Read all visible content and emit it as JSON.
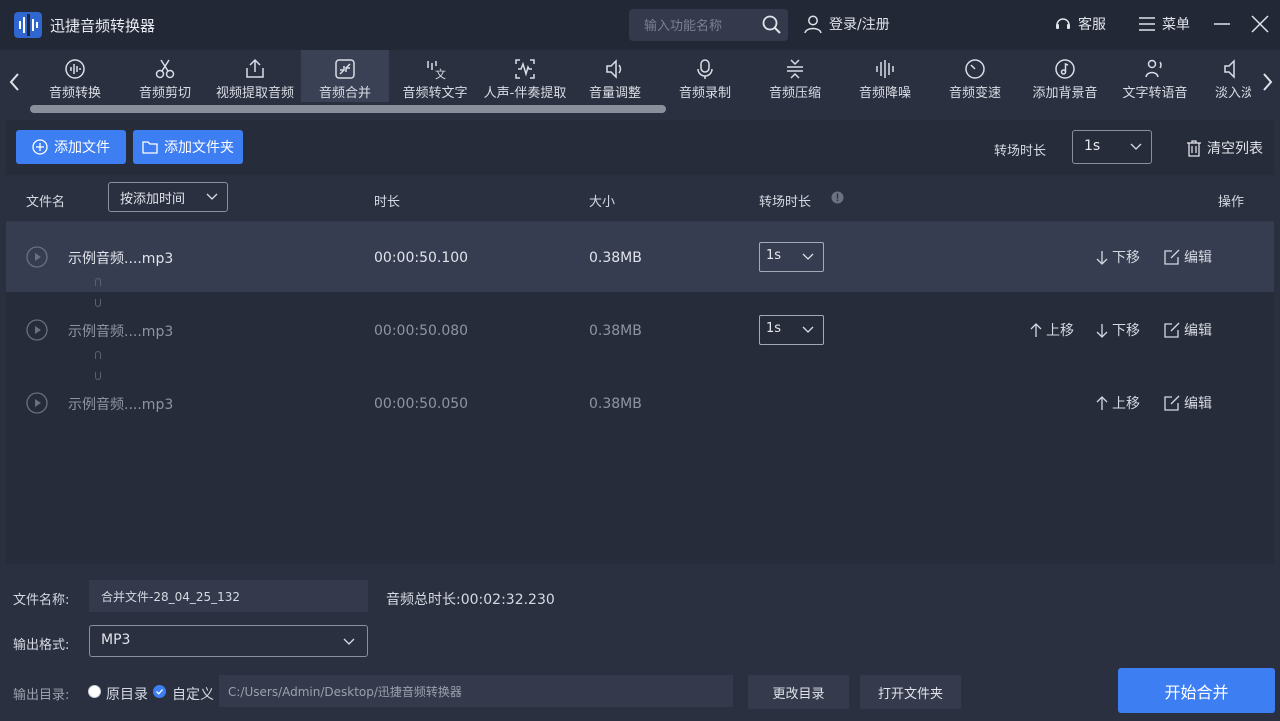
{
  "app": {
    "title": "迅捷音频转换器",
    "search_placeholder": "输入功能名称",
    "login_label": "登录/注册",
    "service_label": "客服",
    "menu_label": "菜单"
  },
  "toolbar": {
    "tools": [
      {
        "label": "音频转换",
        "icon": "waveform-circle-icon"
      },
      {
        "label": "音频剪切",
        "icon": "scissors-icon"
      },
      {
        "label": "视频提取音频",
        "icon": "export-icon"
      },
      {
        "label": "音频合并",
        "icon": "merge-icon",
        "active": true
      },
      {
        "label": "音频转文字",
        "icon": "audio-to-text-icon"
      },
      {
        "label": "人声-伴奏提取",
        "icon": "vocal-extract-icon"
      },
      {
        "label": "音量调整",
        "icon": "volume-icon"
      },
      {
        "label": "音频录制",
        "icon": "microphone-icon"
      },
      {
        "label": "音频压缩",
        "icon": "compress-icon"
      },
      {
        "label": "音频降噪",
        "icon": "denoise-icon"
      },
      {
        "label": "音频变速",
        "icon": "speed-icon"
      },
      {
        "label": "添加背景音",
        "icon": "music-note-icon"
      },
      {
        "label": "文字转语音",
        "icon": "text-to-speech-icon"
      },
      {
        "label": "淡入淡",
        "icon": "fade-icon"
      }
    ]
  },
  "actions": {
    "add_file": "添加文件",
    "add_folder": "添加文件夹",
    "transition_label": "转场时长",
    "transition_value": "1s",
    "clear_list": "清空列表"
  },
  "table": {
    "headers": {
      "filename": "文件名",
      "sort": "按添加时间",
      "duration": "时长",
      "size": "大小",
      "transition": "转场时长",
      "operation": "操作"
    },
    "rows": [
      {
        "name": "示例音频....mp3",
        "duration": "00:00:50.100",
        "size": "0.38MB",
        "transition": "1s",
        "up": "",
        "down": "下移",
        "edit": "编辑"
      },
      {
        "name": "示例音频....mp3",
        "duration": "00:00:50.080",
        "size": "0.38MB",
        "transition": "1s",
        "up": "上移",
        "down": "下移",
        "edit": "编辑"
      },
      {
        "name": "示例音频....mp3",
        "duration": "00:00:50.050",
        "size": "0.38MB",
        "transition": "",
        "up": "上移",
        "down": "",
        "edit": "编辑"
      }
    ]
  },
  "bottom": {
    "filename_label": "文件名称:",
    "filename_value": "合并文件-28_04_25_132",
    "total_label": "音频总时长:",
    "total_value": "00:02:32.230",
    "format_label": "输出格式:",
    "format_value": "MP3",
    "outdir_label": "输出目录:",
    "radio_original": "原目录",
    "radio_custom": "自定义",
    "path_value": "C:/Users/Admin/Desktop/迅捷音频转换器",
    "change_dir": "更改目录",
    "open_folder": "打开文件夹",
    "start": "开始合并"
  },
  "colors": {
    "accent": "#3d7ef3",
    "background": "#2b3040",
    "titlebar": "#232836"
  }
}
